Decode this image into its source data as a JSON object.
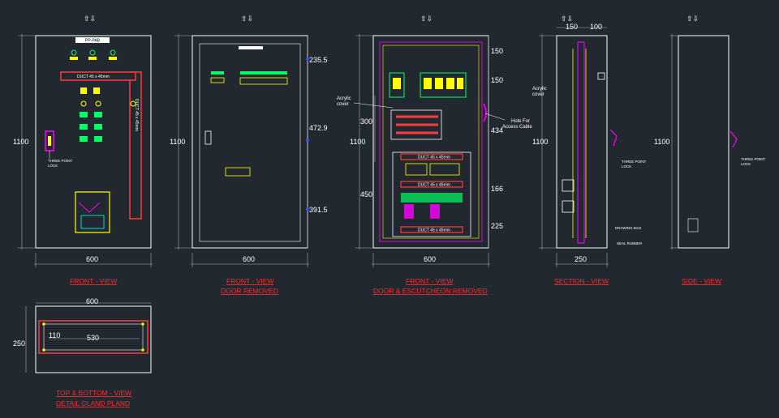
{
  "arrow_symbol": "⇧⇩",
  "overall": {
    "height": "1100",
    "width": "600",
    "depth": "250"
  },
  "front_view": {
    "panel_label": "PP-PAB",
    "duct": "DUCT 45 x 45mm",
    "duct_vertical": "DUCT 45 x 45mm",
    "lock": [
      "THREE POINT",
      "LOCK"
    ],
    "title": "FRONT - VIEW"
  },
  "door_removed": {
    "dims": [
      "235.5",
      "472.9",
      "391.5"
    ],
    "title": [
      "FRONT - VIEW",
      "DOOR REMOVED"
    ]
  },
  "escutcheon_removed": {
    "right_dims": [
      "150",
      "150",
      "434",
      "166",
      "225"
    ],
    "left_dims": [
      "300",
      "450"
    ],
    "acrylic": [
      "Acrylic",
      "cover"
    ],
    "hole": [
      "Hole For",
      "Access Cable"
    ],
    "duct": "DUCT 45 x 45mm",
    "title": [
      "FRONT - VIEW",
      "DOOR & ESCUTCHEON REMOVED"
    ]
  },
  "section_view": {
    "top_dims": [
      "150",
      "100"
    ],
    "width": "250",
    "acrylic": [
      "Acrylic",
      "cover"
    ],
    "lock": [
      "THREE POINT",
      "LOCK"
    ],
    "drawing_bag": "DRAWING BAG",
    "seal": "SEAL RUBBER",
    "title": "SECTION - VIEW"
  },
  "side_view": {
    "lock": [
      "THREE POINT",
      "LOCK"
    ],
    "title": "SIDE - VIEW"
  },
  "top_bottom": {
    "inner": "530",
    "offset": "110",
    "title": [
      "TOP & BOTTOM - VIEW",
      "DETAIL GLAND PLAND"
    ]
  },
  "colors": {
    "background": "#212830",
    "title": "#ff2a2a",
    "outline": "#ffffff",
    "bus": "#ff3b3b",
    "breaker": "#ffff00",
    "accent": "#00ff66",
    "cyan": "#00ffff",
    "magenta": "#ff00ff"
  }
}
